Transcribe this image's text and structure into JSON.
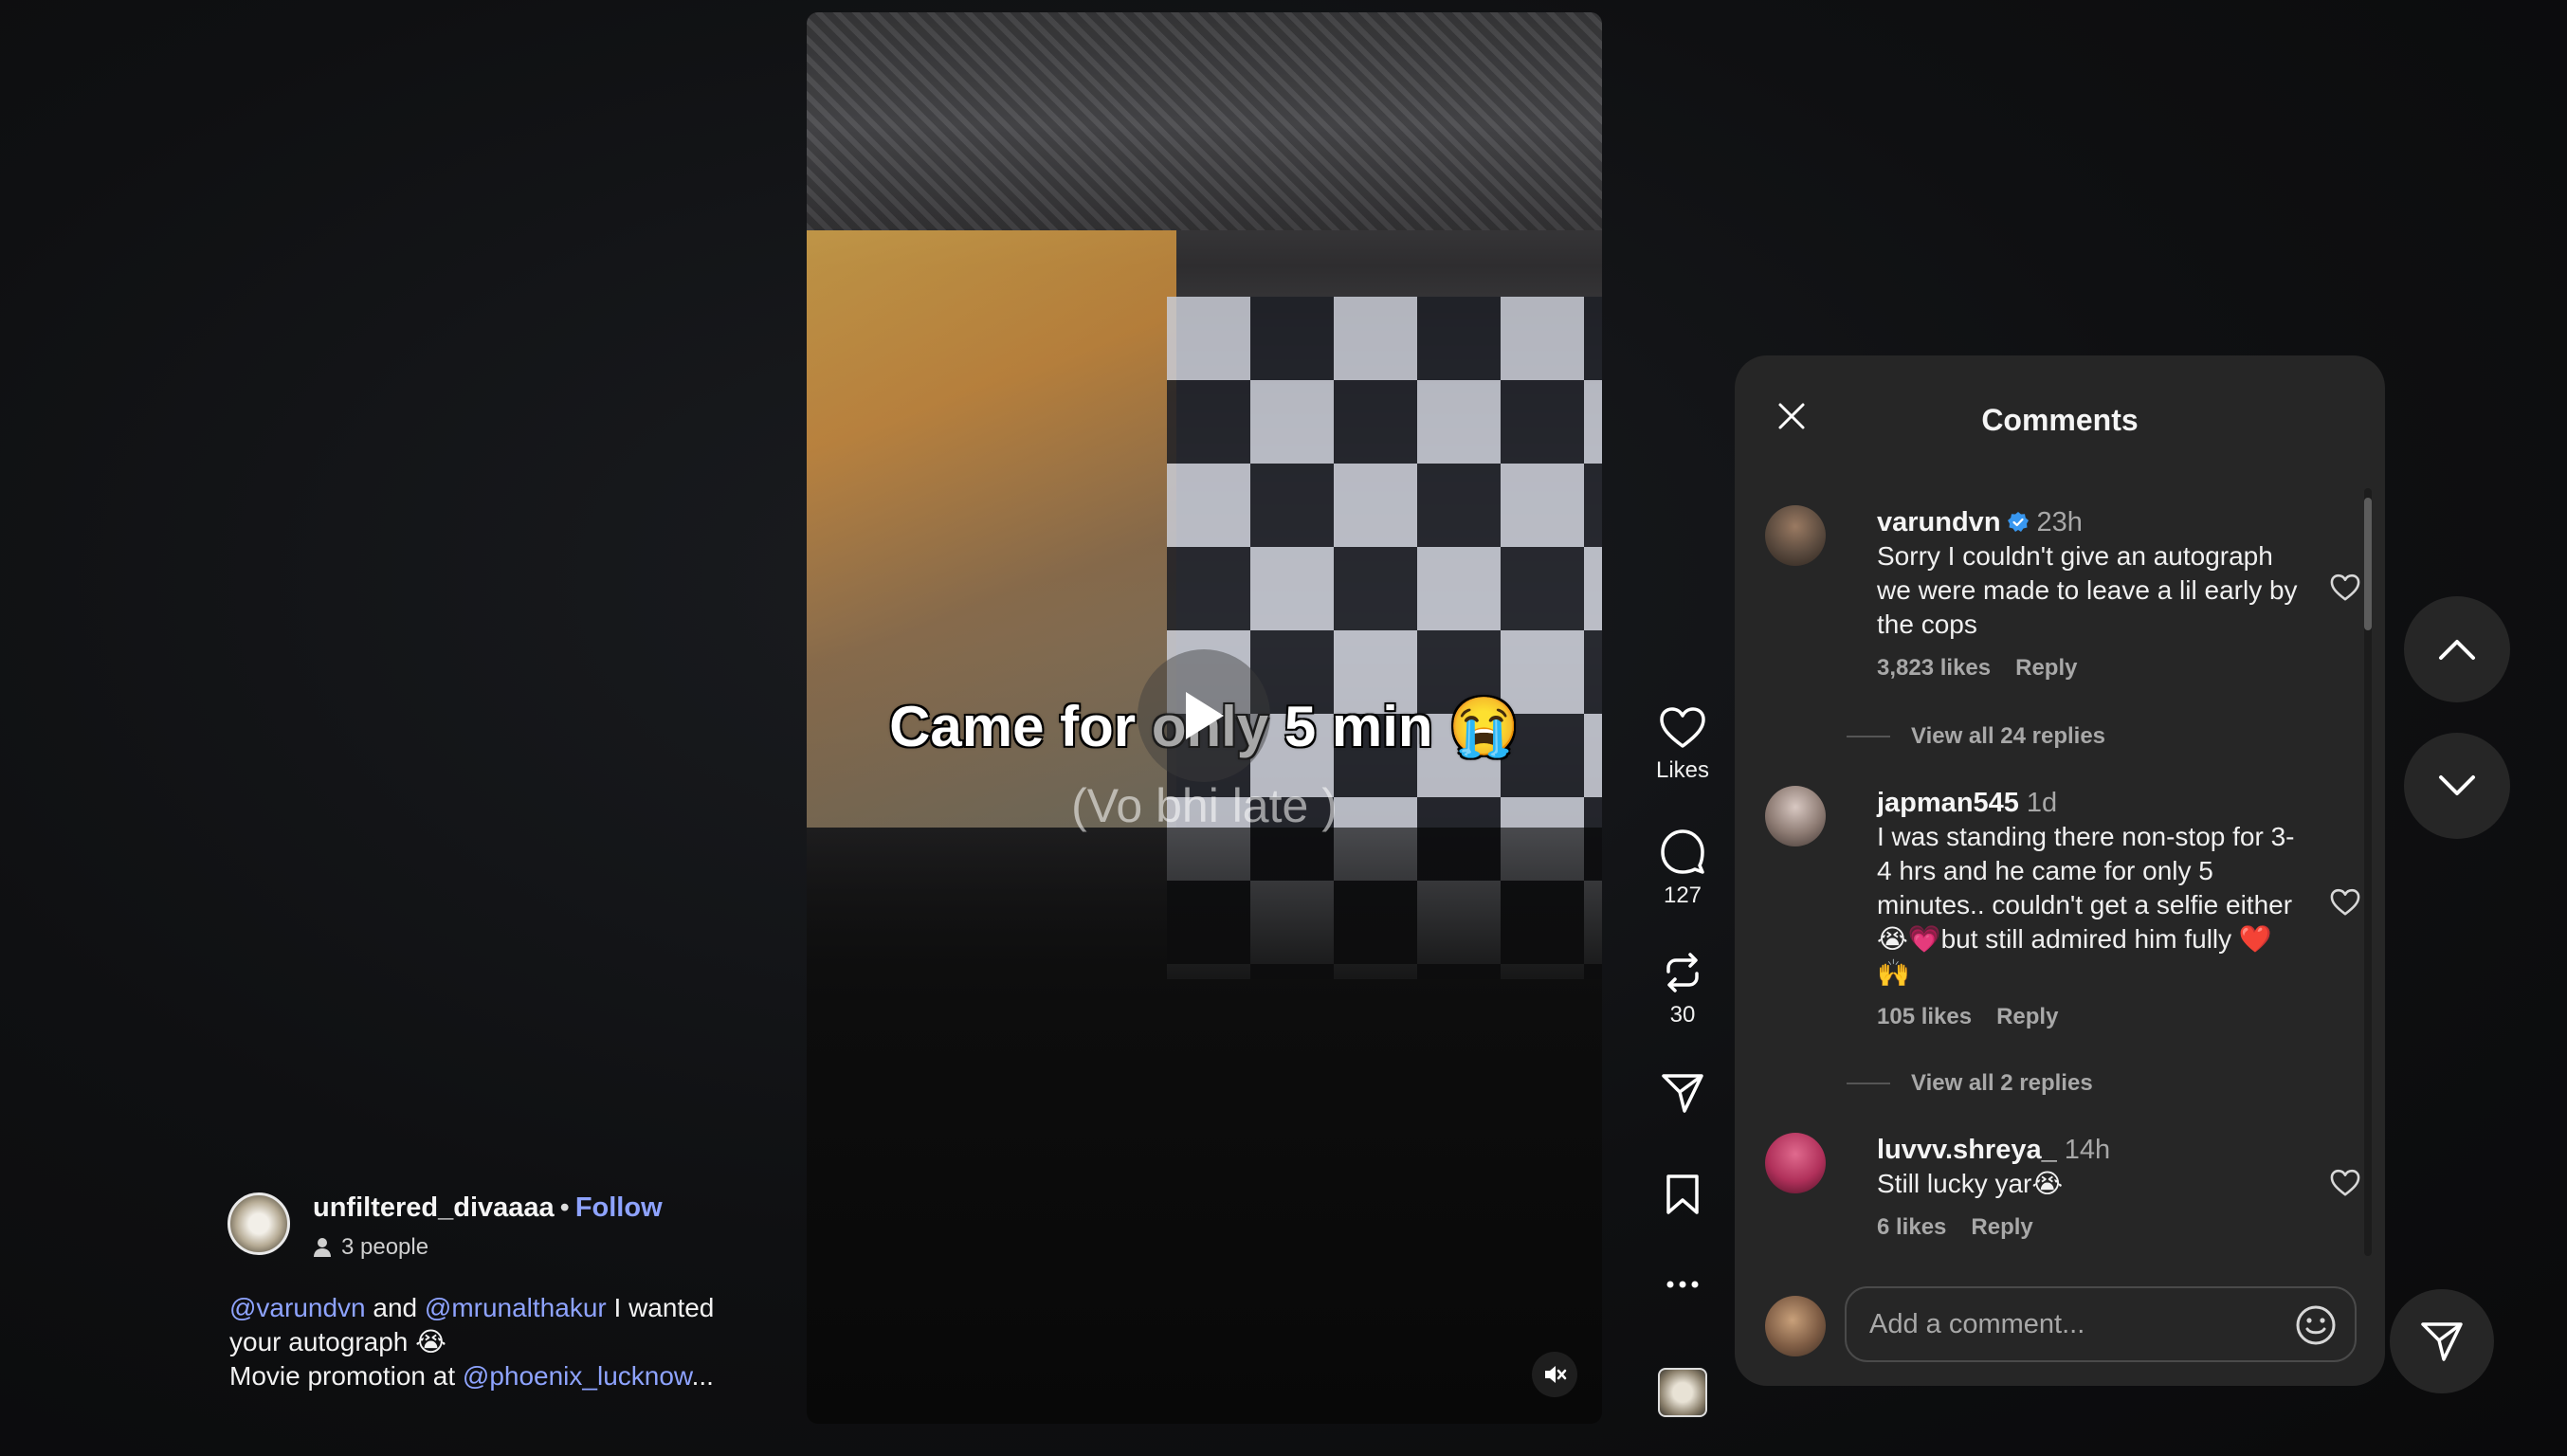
{
  "video": {
    "caption_main": "Came for only 5 min 😭",
    "caption_sub": "(Vo bhi late )",
    "icons": {
      "play": "play-icon",
      "mute": "muted-speaker-icon"
    }
  },
  "actions": {
    "likes_label": "Likes",
    "comments_count": "127",
    "reposts_count": "30",
    "icons": [
      "heart-icon",
      "comment-icon",
      "repost-icon",
      "share-icon",
      "bookmark-icon",
      "more-icon"
    ]
  },
  "author": {
    "username": "unfiltered_divaaaa",
    "separator": "•",
    "follow_label": "Follow",
    "people_label": "3 people"
  },
  "post_caption": {
    "mention1": "@varundvn",
    "and_text": " and ",
    "mention2": "@mrunalthakur",
    "text1": " I wanted your autograph 😭",
    "line2_prefix": "Movie promotion at ",
    "mention3": "@phoenix_lucknow",
    "ellipsis": "..."
  },
  "comments_panel": {
    "title": "Comments",
    "comments": [
      {
        "username": "varundvn",
        "verified": true,
        "time": "23h",
        "text": "Sorry I couldn't give an autograph we were made to leave a lil early by the cops",
        "likes": "3,823 likes",
        "reply_label": "Reply",
        "view_replies": "View all 24 replies",
        "avatar_color": "#5a4a3e"
      },
      {
        "username": "japman545",
        "verified": false,
        "time": "1d",
        "text": "I was standing there non-stop for 3-4 hrs and he came for only 5 minutes.. couldn't get a selfie either 😭💗but still admired him fully ❤️🙌",
        "likes": "105 likes",
        "reply_label": "Reply",
        "view_replies": "View all 2 replies",
        "avatar_color": "#8c7a72"
      },
      {
        "username": "luvvv.shreya_",
        "verified": false,
        "time": "14h",
        "text": "Still lucky yar😭",
        "likes": "6 likes",
        "reply_label": "Reply",
        "avatar_color": "#b0305a"
      }
    ],
    "add_comment_placeholder": "Add a comment...",
    "accent_link_color": "#8ea3ff",
    "verified_color": "#3897f0"
  },
  "navigation": {
    "icons": [
      "chevron-up-icon",
      "chevron-down-icon",
      "send-icon"
    ]
  }
}
